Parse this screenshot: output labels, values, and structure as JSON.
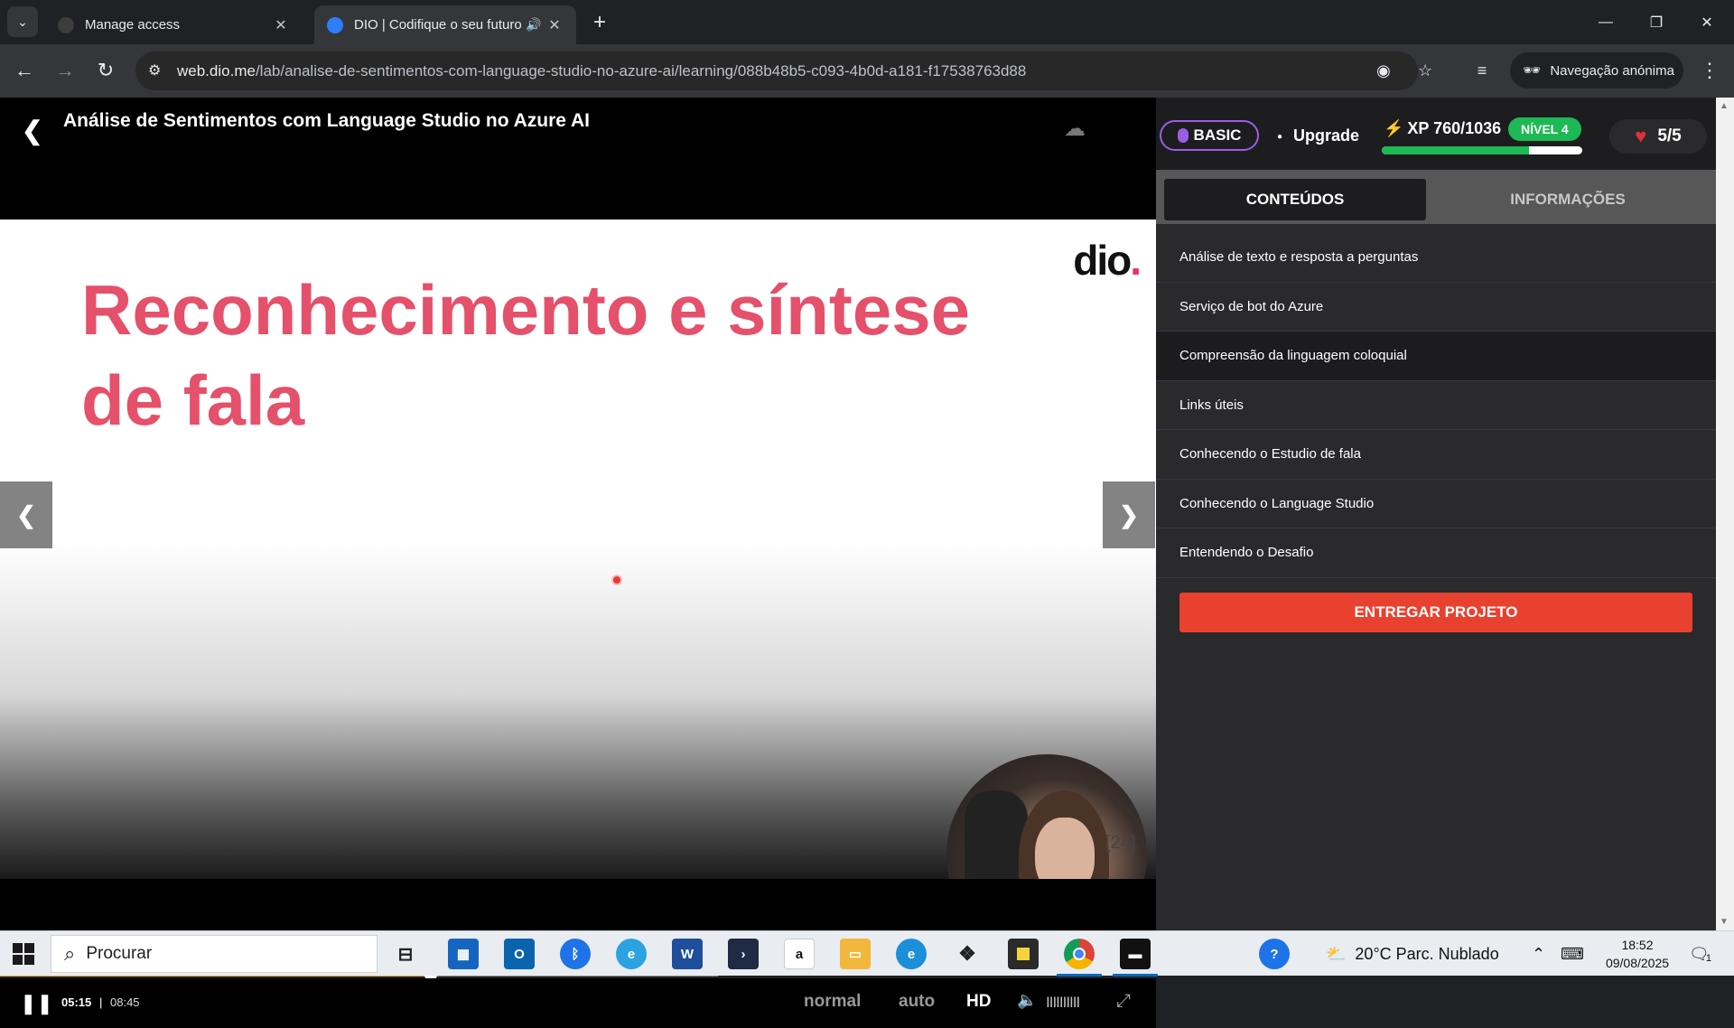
{
  "browser": {
    "tabs": [
      {
        "title": "Manage access",
        "active": false
      },
      {
        "title": "DIO | Codifique o seu futuro",
        "active": true
      }
    ],
    "url_host": "web.dio.me",
    "url_path": "/lab/analise-de-sentimentos-com-language-studio-no-azure-ai/learning/088b48b5-c093-4b0d-a181-f17538763d88",
    "incognito_label": "Navegação anónima"
  },
  "player": {
    "course_title": "Análise de Sentimentos com Language Studio no Azure AI",
    "slide_title": "Reconhecimento e síntese de fala",
    "logo_text": "dio",
    "slide_counter": "[24]",
    "current_time": "05:15",
    "separator": "|",
    "duration": "08:45",
    "progress_fraction": 0.6,
    "buffered_fraction": 0.62,
    "speed_label": "normal",
    "quality_label": "auto",
    "hd_label": "HD",
    "volume_bars": "IIIIIIIIII"
  },
  "sidebar": {
    "plan_badge": "BASIC",
    "upgrade_label": "Upgrade",
    "xp_label": "XP 760/1036",
    "xp_fraction": 0.7336,
    "level_label": "NÍVEL 4",
    "lives_label": "5/5",
    "tabs": [
      {
        "label": "CONTEÚDOS",
        "active": true
      },
      {
        "label": "INFORMAÇÕES",
        "active": false
      }
    ],
    "lessons": [
      {
        "label": "Análise de texto e resposta a perguntas"
      },
      {
        "label": "Serviço de bot do Azure"
      },
      {
        "label": "Compreensão da linguagem coloquial",
        "current": true
      },
      {
        "label": "Links úteis"
      },
      {
        "label": "Conhecendo o Estudio de fala"
      },
      {
        "label": "Conhecendo o Language Studio"
      },
      {
        "label": "Entendendo o Desafio"
      }
    ],
    "submit_label": "ENTREGAR PROJETO"
  },
  "taskbar": {
    "search_placeholder": "Procurar",
    "weather": "20°C  Parc. Nublado",
    "time": "18:52",
    "date": "09/08/2025",
    "notification_count": "1"
  },
  "colors": {
    "accent_orange": "#e8412f",
    "slide_title_pink": "#e5506a",
    "level_green": "#1db954",
    "basic_purple": "#9b5de5"
  }
}
